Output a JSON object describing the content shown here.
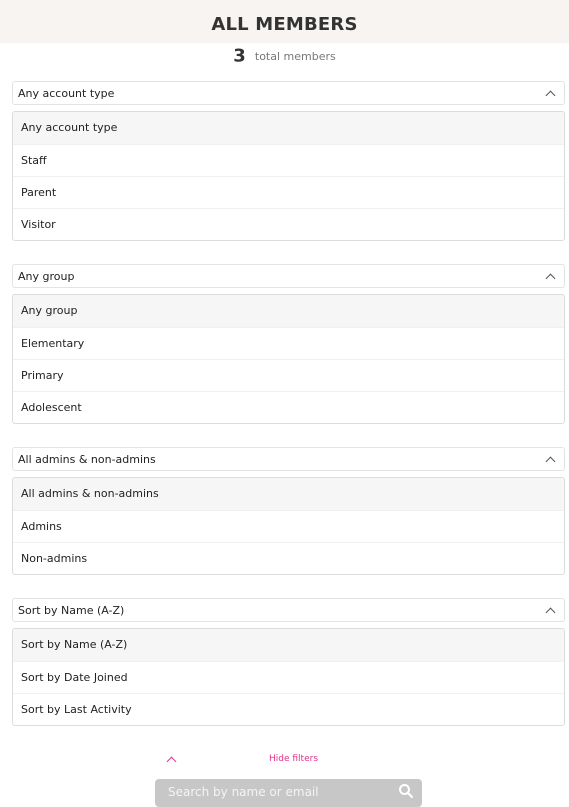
{
  "header": {
    "title": "ALL MEMBERS"
  },
  "summary": {
    "count": "3",
    "label": "total members"
  },
  "filters": [
    {
      "selected": "Any account type",
      "options": [
        "Any account type",
        "Staff",
        "Parent",
        "Visitor"
      ]
    },
    {
      "selected": "Any group",
      "options": [
        "Any group",
        "Elementary",
        "Primary",
        "Adolescent"
      ]
    },
    {
      "selected": "All admins & non-admins",
      "options": [
        "All admins & non-admins",
        "Admins",
        "Non-admins"
      ]
    },
    {
      "selected": "Sort by Name (A-Z)",
      "options": [
        "Sort by Name (A-Z)",
        "Sort by Date Joined",
        "Sort by Last Activity"
      ]
    }
  ],
  "hide_filters": {
    "label": "Hide filters"
  },
  "search": {
    "placeholder": "Search by name or email"
  },
  "colors": {
    "accent": "#e0348a",
    "header_bg": "#f7f4f1",
    "search_bg": "#c7c7c7"
  }
}
